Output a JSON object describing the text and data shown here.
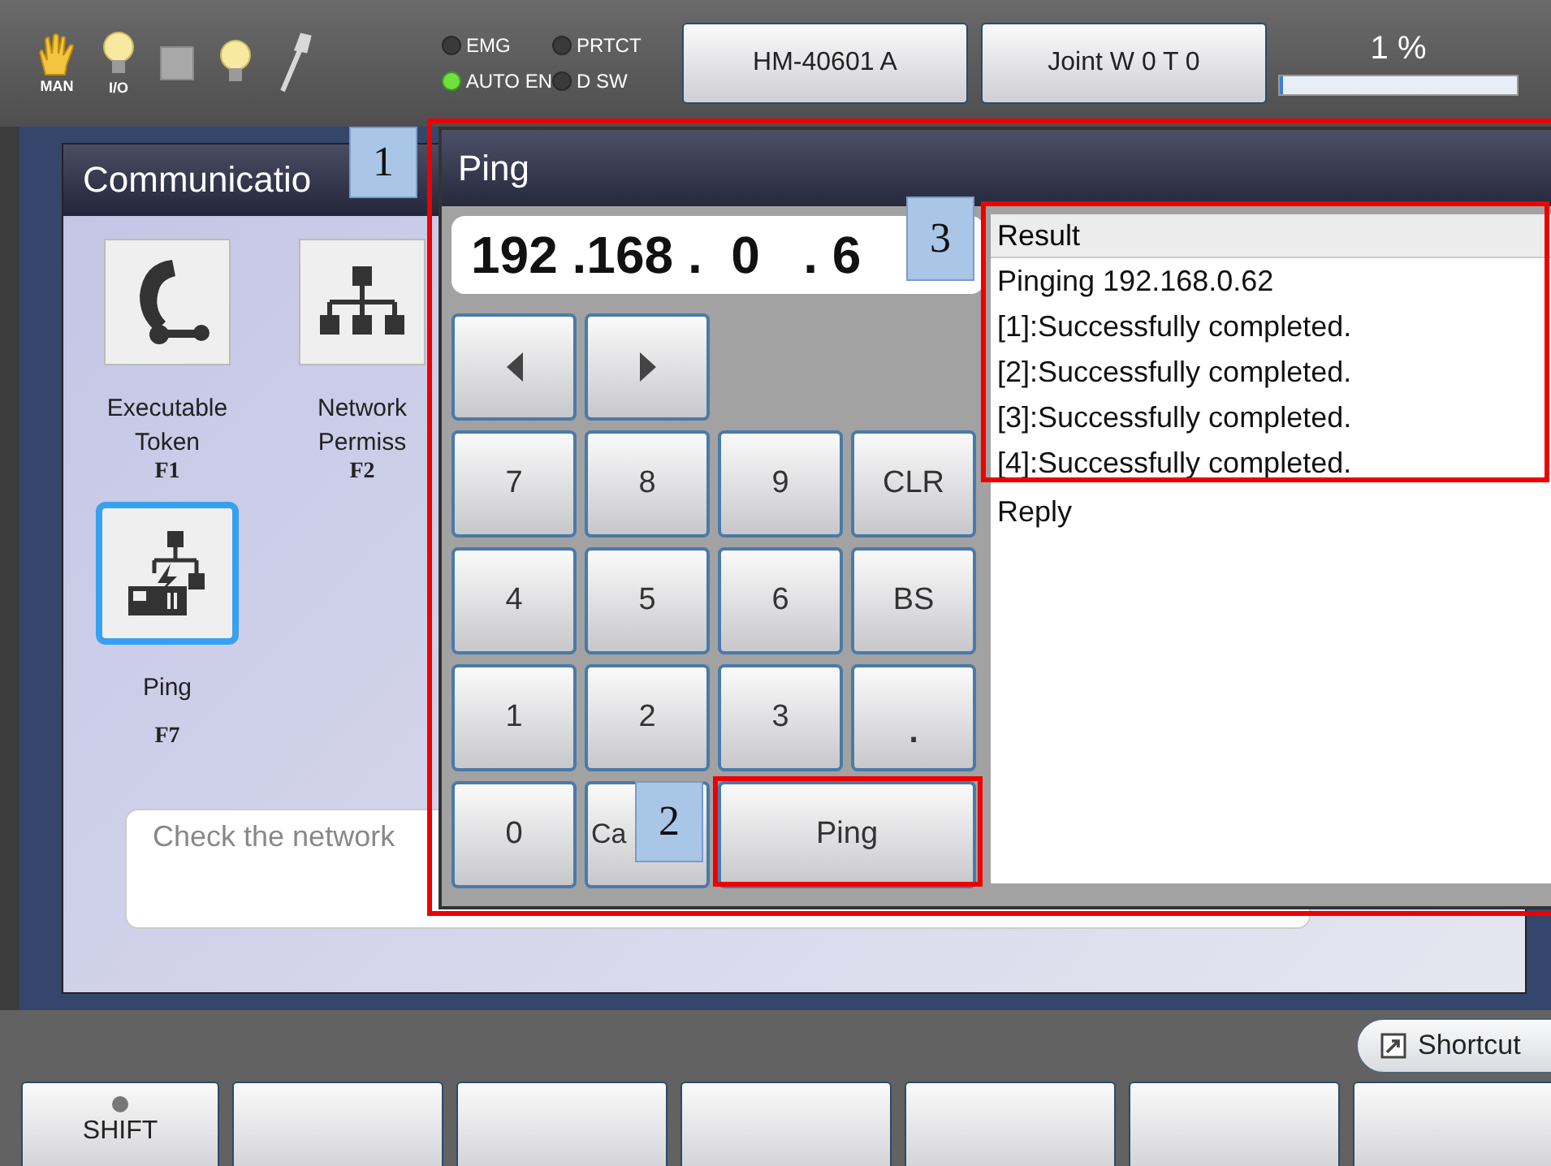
{
  "top_bar": {
    "icons": [
      {
        "kind": "hand",
        "label": "MAN"
      },
      {
        "kind": "bulb",
        "label": "I/O"
      },
      {
        "kind": "square"
      },
      {
        "kind": "bulb"
      },
      {
        "kind": "wrench"
      }
    ],
    "indicators": [
      {
        "label": "EMG",
        "on": false
      },
      {
        "label": "PRTCT",
        "on": false
      },
      {
        "label": "AUTO EN",
        "on": true
      },
      {
        "label": "D SW",
        "on": false
      }
    ],
    "buttons": [
      "HM-40601 A",
      "Joint W 0 T 0"
    ],
    "progress": {
      "reading": "1 %",
      "level": 0.01
    }
  },
  "panel": {
    "title": "Communicatio",
    "items": [
      {
        "kind": "phone-key",
        "lines": [
          "Executable",
          "Token"
        ],
        "key": "F1",
        "selected": false
      },
      {
        "kind": "network",
        "lines": [
          "Network",
          "Permiss"
        ],
        "key": "F2",
        "selected": false
      },
      {
        "kind": "ping",
        "lines": [
          "Ping"
        ],
        "key": "F7",
        "selected": true
      }
    ],
    "description": "Check the network"
  },
  "dialog": {
    "title": "Ping",
    "address": "192 .168 .  0   . 6",
    "arrows": [
      {
        "kind": "left"
      },
      {
        "kind": "right"
      }
    ],
    "keys": [
      {
        "label": "7",
        "kind": "key"
      },
      {
        "label": "8",
        "kind": "key"
      },
      {
        "label": "9",
        "kind": "key"
      },
      {
        "label": "CLR",
        "kind": "key"
      },
      {
        "label": "4",
        "kind": "key"
      },
      {
        "label": "5",
        "kind": "key"
      },
      {
        "label": "6",
        "kind": "key"
      },
      {
        "label": "BS",
        "kind": "key"
      },
      {
        "label": "1",
        "kind": "key"
      },
      {
        "label": "2",
        "kind": "key"
      },
      {
        "label": "3",
        "kind": "key"
      },
      {
        "label": ".",
        "kind": "dot"
      },
      {
        "label": "0",
        "kind": "key"
      },
      {
        "label": "Ca",
        "kind": "partial"
      },
      {
        "label": "Ping",
        "kind": "wide"
      }
    ],
    "result": {
      "header": "Result",
      "lines": [
        "Pinging 192.168.0.62",
        "[1]:Successfully completed.",
        "[2]:Successfully completed.",
        "[3]:Successfully completed.",
        "[4]:Successfully completed."
      ],
      "reply": "Reply"
    }
  },
  "shortcut": "Shortcut",
  "function_keys": [
    {
      "kind": "shift",
      "label": "SHIFT",
      "led_on": false
    },
    {
      "kind": "blank"
    },
    {
      "kind": "blank"
    },
    {
      "kind": "blank"
    },
    {
      "kind": "blank"
    },
    {
      "kind": "blank"
    },
    {
      "kind": "blank"
    }
  ],
  "callouts": [
    "1",
    "2",
    "3"
  ]
}
